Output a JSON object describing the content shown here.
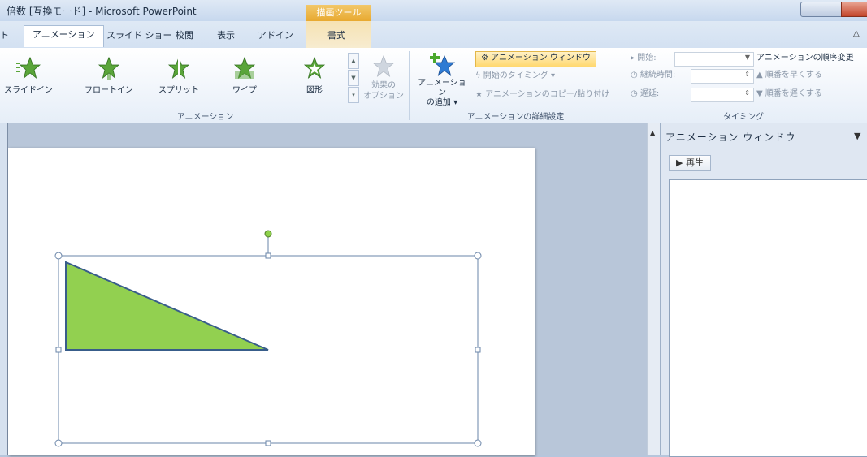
{
  "window": {
    "title": "倍数 [互換モード] - Microsoft PowerPoint",
    "context_tab_group": "描画ツール"
  },
  "tabs": [
    {
      "label": "ト"
    },
    {
      "label": "アニメーション",
      "active": true
    },
    {
      "label": "スライド ショー"
    },
    {
      "label": "校閲"
    },
    {
      "label": "表示"
    },
    {
      "label": "アドイン"
    },
    {
      "label": "書式"
    }
  ],
  "ribbon": {
    "animation_group": {
      "label": "アニメーション",
      "items": [
        {
          "label": "スライドイン",
          "icon": "slide-in-star-icon"
        },
        {
          "label": "フロートイン",
          "icon": "float-in-star-icon"
        },
        {
          "label": "スプリット",
          "icon": "split-star-icon"
        },
        {
          "label": "ワイプ",
          "icon": "wipe-star-icon"
        },
        {
          "label": "図形",
          "icon": "shape-star-icon"
        }
      ],
      "effect_options_line1": "効果の",
      "effect_options_line2": "オプション"
    },
    "advanced_group": {
      "label": "アニメーションの詳細設定",
      "add_animation_line1": "アニメーション",
      "add_animation_line2": "の追加",
      "animation_window": "アニメーション ウィンドウ",
      "trigger": "開始のタイミング",
      "animation_painter": "アニメーションのコピー/貼り付け"
    },
    "timing_group": {
      "label": "タイミング",
      "start": "開始:",
      "duration": "継続時間:",
      "delay": "遅延:",
      "reorder_title": "アニメーションの順序変更",
      "move_earlier": "順番を早くする",
      "move_later": "順番を遅くする"
    }
  },
  "animation_pane": {
    "title": "アニメーション ウィンドウ",
    "play_button": "再生"
  },
  "colors": {
    "triangle_fill": "#92d050",
    "triangle_stroke": "#385d8a",
    "accent_star": "#5aa53a",
    "highlight_button": "#ffd86f"
  }
}
